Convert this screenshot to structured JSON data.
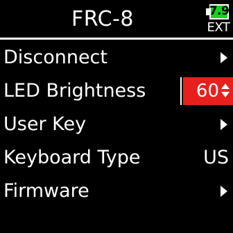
{
  "header": {
    "title": "FRC-8",
    "battery": {
      "level": "7.9",
      "source": "EXT",
      "color": "#17d21c"
    }
  },
  "menu": {
    "items": [
      {
        "label": "Disconnect",
        "value": "",
        "indicator": "chevron-right-icon"
      },
      {
        "label": "LED Brightness",
        "value": "60",
        "indicator": "up-down-arrows-icon",
        "selected": true,
        "highlight_color": "#e8201d"
      },
      {
        "label": "User Key",
        "value": "",
        "indicator": "chevron-right-icon"
      },
      {
        "label": "Keyboard Type",
        "value": "US",
        "indicator": ""
      },
      {
        "label": "Firmware",
        "value": "",
        "indicator": "chevron-right-icon"
      }
    ]
  }
}
